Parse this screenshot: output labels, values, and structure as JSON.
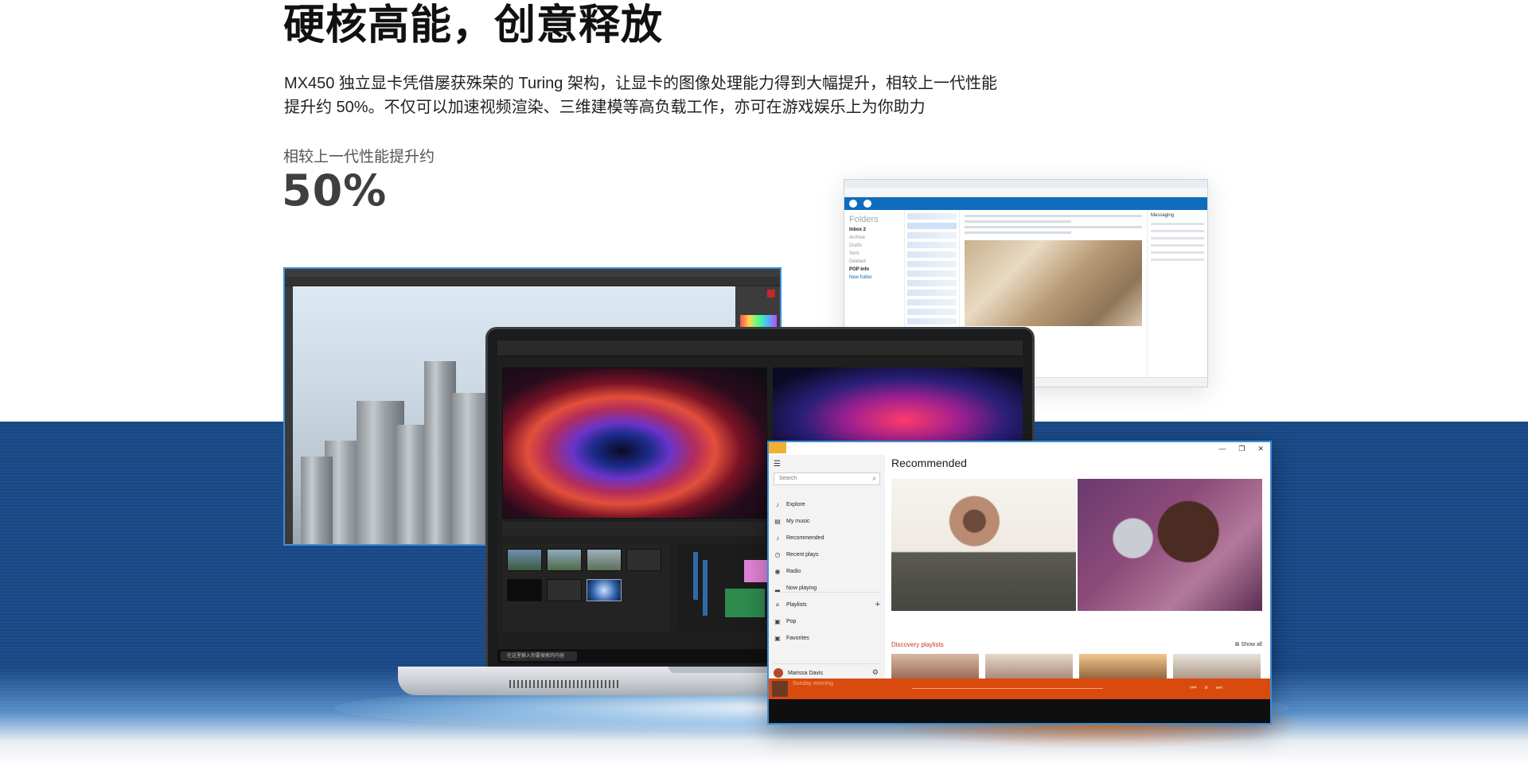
{
  "hero": {
    "headline": "硬核高能，创意释放",
    "description_line1": "MX450 独立显卡凭借屡获殊荣的 Turing 架构，让显卡的图像处理能力得到大幅提升，相较上一代性能",
    "description_line2": "提升约 50%。不仅可以加速视频渲染、三维建模等高负载工作，亦可在游戏娱乐上为你助力",
    "stat_label": "相较上一代性能提升约",
    "stat_value": "50%"
  },
  "outlook": {
    "folders_heading": "Folders",
    "folders": [
      {
        "label": "Inbox  2",
        "style": "b"
      },
      {
        "label": "Archive",
        "style": ""
      },
      {
        "label": "Drafts",
        "style": ""
      },
      {
        "label": "Sent",
        "style": ""
      },
      {
        "label": "Deleted",
        "style": ""
      },
      {
        "label": "POP Info",
        "style": "b"
      },
      {
        "label": "New folder",
        "style": "l"
      }
    ],
    "messaging_label": "Messaging"
  },
  "laptop": {
    "taskbar_search": "在这里输入你要搜索的内容"
  },
  "music_app": {
    "window_controls": [
      "—",
      "❐",
      "✕"
    ],
    "search_placeholder": "Search",
    "nav_items": [
      {
        "label": "Explore",
        "icon": "headphones-icon",
        "glyph": "♪"
      },
      {
        "label": "My music",
        "icon": "music-library-icon",
        "glyph": "▤"
      },
      {
        "label": "Recommended",
        "icon": "headphones-icon",
        "glyph": "♪"
      },
      {
        "label": "Recent plays",
        "icon": "clock-icon",
        "glyph": "◷"
      },
      {
        "label": "Radio",
        "icon": "radio-icon",
        "glyph": "◉"
      },
      {
        "label": "Now playing",
        "icon": "equalizer-icon",
        "glyph": "▂"
      }
    ],
    "playlist_items": [
      {
        "label": "Playlists",
        "icon": "playlist-icon",
        "glyph": "≡"
      },
      {
        "label": "Pop",
        "icon": "playlist-item-icon",
        "glyph": "▣"
      },
      {
        "label": "Favorites",
        "icon": "playlist-item-icon",
        "glyph": "▣"
      }
    ],
    "add_glyph": "+",
    "user_name": "Marissa Davis",
    "settings_glyph": "⚙",
    "recommended_heading": "Recommended",
    "discovery_heading": "Discovery playlists",
    "show_all": "⊞ Show all",
    "now_playing_title": "Sunday morning",
    "player_controls": "⏮⏸⏭",
    "colors": {
      "accent": "#d94a0f",
      "selection_border": "#3a8fd6"
    }
  }
}
